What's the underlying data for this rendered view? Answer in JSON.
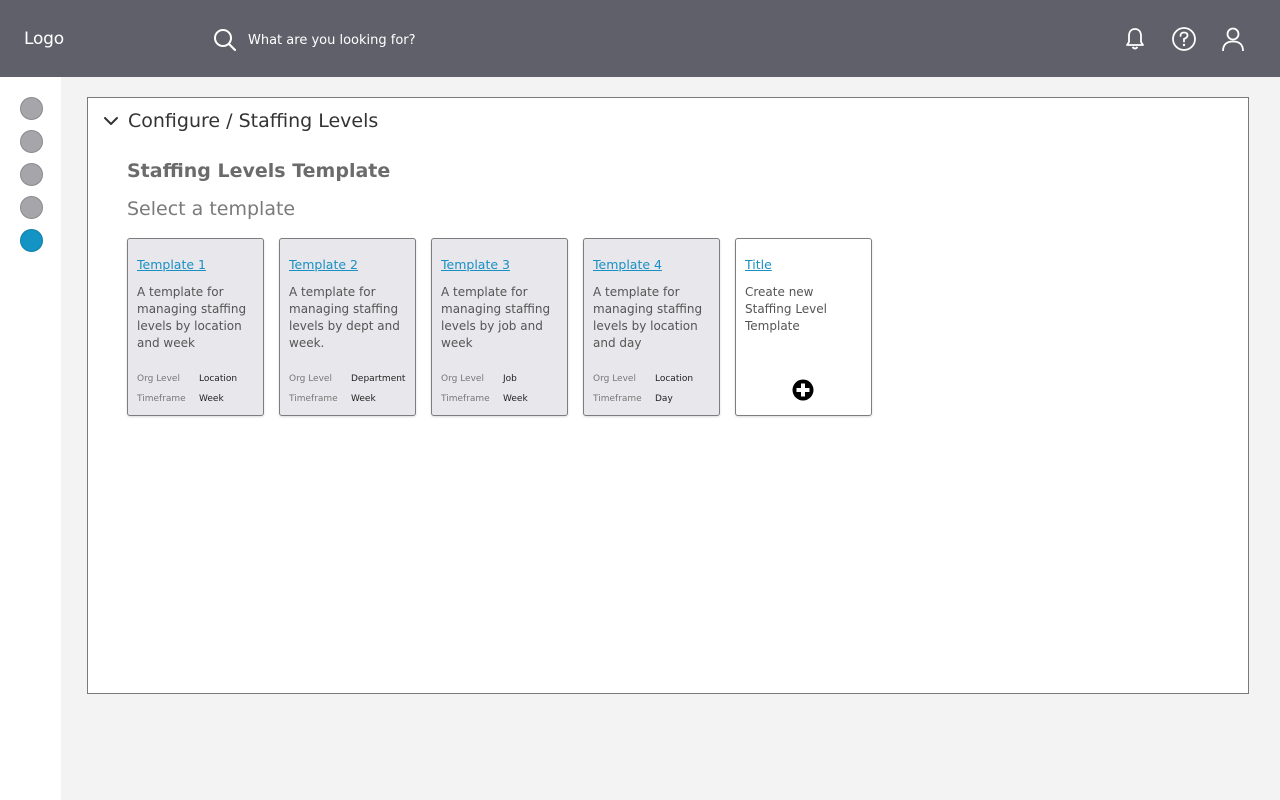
{
  "header": {
    "logo": "Logo",
    "search_placeholder": "What are you looking for?"
  },
  "icons": {
    "search": "search-icon",
    "notifications": "bell-icon",
    "help": "help-icon",
    "user": "user-icon",
    "collapse": "chevron-down-icon",
    "add": "plus-circle-icon"
  },
  "colors": {
    "topbar": "#5f6069",
    "accent": "#1394c4",
    "rail_inactive": "#a6a6aa"
  },
  "panel": {
    "breadcrumb": "Configure / Staffing Levels",
    "title": "Staffing Levels Template",
    "subtitle": "Select a template"
  },
  "templates": [
    {
      "title": "Template 1",
      "description": "A template for managing staffing levels by location and week",
      "org_level_label": "Org Level",
      "org_level": "Location",
      "timeframe_label": "Timeframe",
      "timeframe": "Week"
    },
    {
      "title": "Template 2",
      "description": "A template for managing staffing levels by dept and week.",
      "org_level_label": "Org Level",
      "org_level": "Department",
      "timeframe_label": "Timeframe",
      "timeframe": "Week"
    },
    {
      "title": "Template 3",
      "description": "A template for managing staffing levels by job and week",
      "org_level_label": "Org Level",
      "org_level": "Job",
      "timeframe_label": "Timeframe",
      "timeframe": "Week"
    },
    {
      "title": "Template 4",
      "description": "A template for managing staffing levels by location and day",
      "org_level_label": "Org Level",
      "org_level": "Location",
      "timeframe_label": "Timeframe",
      "timeframe": "Day"
    }
  ],
  "new_template": {
    "title": "Title",
    "description": "Create new Staffing Level Template"
  }
}
